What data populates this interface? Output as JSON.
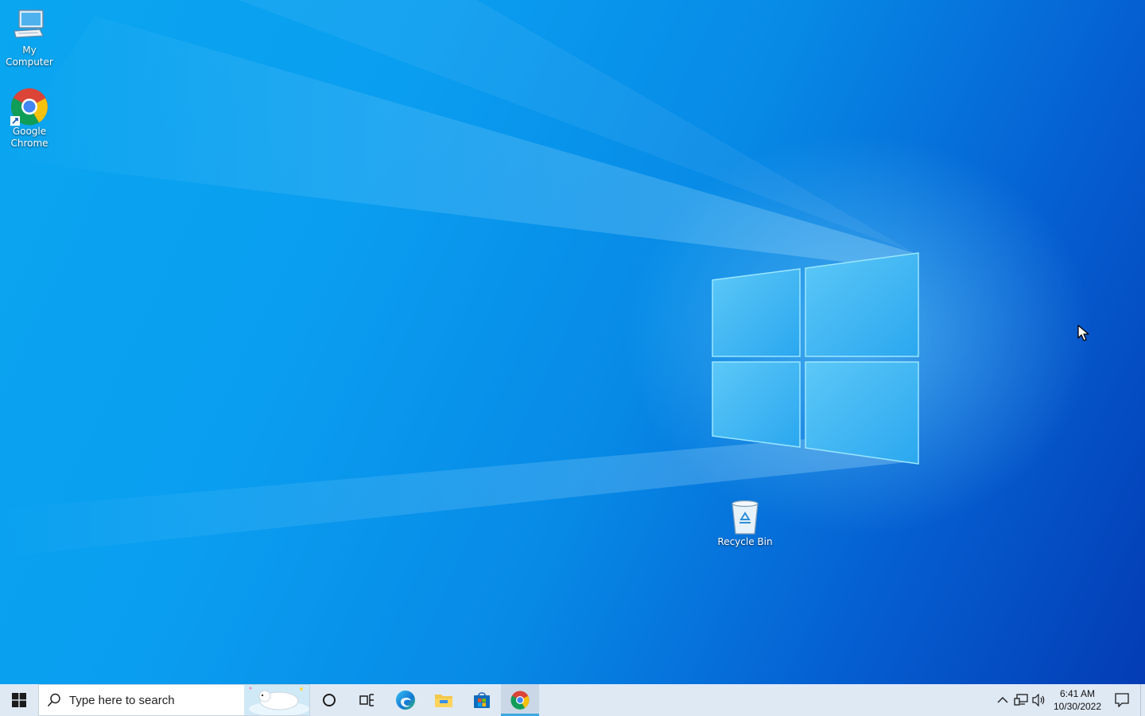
{
  "desktop": {
    "icons": [
      {
        "label": "My\nComputer",
        "icon": "my-computer-icon"
      },
      {
        "label": "Google\nChrome",
        "icon": "chrome-icon"
      },
      {
        "label": "Recycle Bin",
        "icon": "recycle-bin-icon"
      }
    ],
    "wallpaper": {
      "accent_light": "#7fdcff",
      "accent_deep": "#043cb4"
    }
  },
  "taskbar": {
    "start_icon": "windows-start-icon",
    "search_placeholder": "Type here to search",
    "pinned": [
      {
        "name": "cortana",
        "icon": "cortana-circle-icon"
      },
      {
        "name": "task-view",
        "icon": "task-view-icon"
      },
      {
        "name": "edge",
        "icon": "edge-icon"
      },
      {
        "name": "file-explorer",
        "icon": "folder-icon"
      },
      {
        "name": "store",
        "icon": "store-icon"
      },
      {
        "name": "chrome",
        "icon": "chrome-icon",
        "active": true
      }
    ],
    "tray": {
      "icons": [
        "chevron-up-icon",
        "network-icon",
        "volume-icon"
      ],
      "time": "6:41 AM",
      "date": "10/30/2022",
      "notification_icon": "notification-icon"
    },
    "colors": {
      "background": "#dfe9f4",
      "active_indicator": "#3ba9e0"
    }
  }
}
